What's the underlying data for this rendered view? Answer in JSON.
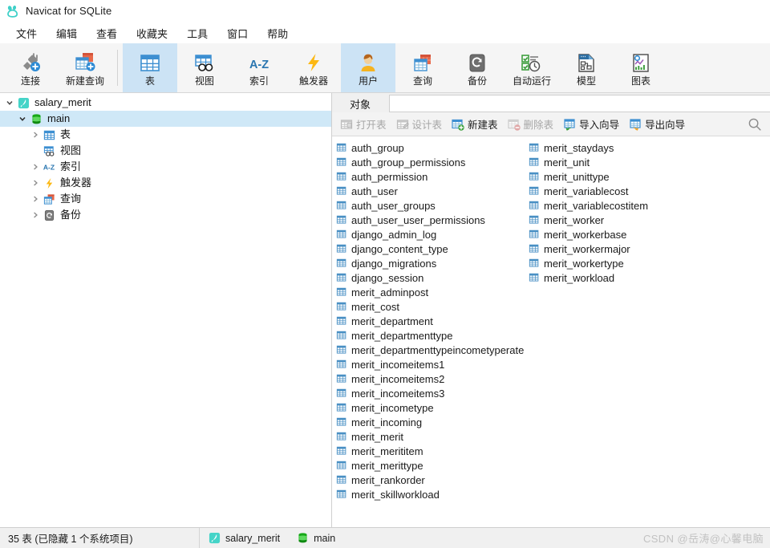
{
  "window": {
    "title": "Navicat for SQLite",
    "logo_icon": "navicat-paw-icon"
  },
  "menubar": {
    "items": [
      {
        "label": "文件",
        "name": "menu-file"
      },
      {
        "label": "编辑",
        "name": "menu-edit"
      },
      {
        "label": "查看",
        "name": "menu-view"
      },
      {
        "label": "收藏夹",
        "name": "menu-favorites"
      },
      {
        "label": "工具",
        "name": "menu-tools"
      },
      {
        "label": "窗口",
        "name": "menu-window"
      },
      {
        "label": "帮助",
        "name": "menu-help"
      }
    ]
  },
  "toolbar": {
    "items": [
      {
        "label": "连接",
        "icon": "connection-plug-icon",
        "active": false
      },
      {
        "label": "新建查询",
        "icon": "new-query-icon",
        "active": false
      },
      {
        "label": "表",
        "icon": "table-icon",
        "active": true
      },
      {
        "label": "视图",
        "icon": "view-icon",
        "active": false
      },
      {
        "label": "索引",
        "icon": "index-az-icon",
        "active": false
      },
      {
        "label": "触发器",
        "icon": "trigger-bolt-icon",
        "active": false
      },
      {
        "label": "用户",
        "icon": "user-icon",
        "active": true
      },
      {
        "label": "查询",
        "icon": "query-icon",
        "active": false
      },
      {
        "label": "备份",
        "icon": "backup-icon",
        "active": false
      },
      {
        "label": "自动运行",
        "icon": "automation-icon",
        "active": false
      },
      {
        "label": "模型",
        "icon": "model-icon",
        "active": false
      },
      {
        "label": "图表",
        "icon": "chart-icon",
        "active": false
      }
    ]
  },
  "sidebar": {
    "nodes": [
      {
        "label": "salary_merit",
        "icon": "sqlite-file-icon",
        "indent": 0,
        "twisty": "expanded",
        "selected": false
      },
      {
        "label": "main",
        "icon": "database-icon",
        "indent": 1,
        "twisty": "expanded",
        "selected": true
      },
      {
        "label": "表",
        "icon": "table-icon",
        "indent": 2,
        "twisty": "collapsed",
        "selected": false
      },
      {
        "label": "视图",
        "icon": "view-icon",
        "indent": 2,
        "twisty": "none",
        "selected": false
      },
      {
        "label": "索引",
        "icon": "index-az-icon",
        "indent": 2,
        "twisty": "collapsed",
        "selected": false
      },
      {
        "label": "触发器",
        "icon": "trigger-bolt-icon",
        "indent": 2,
        "twisty": "collapsed",
        "selected": false
      },
      {
        "label": "查询",
        "icon": "query-icon",
        "indent": 2,
        "twisty": "collapsed",
        "selected": false
      },
      {
        "label": "备份",
        "icon": "backup-icon",
        "indent": 2,
        "twisty": "collapsed",
        "selected": false
      }
    ]
  },
  "main": {
    "tab": {
      "label": "对象",
      "name": "tab-objects"
    },
    "objectbar": {
      "items": [
        {
          "label": "打开表",
          "icon": "open-table-icon",
          "disabled": true,
          "name": "open-table-button"
        },
        {
          "label": "设计表",
          "icon": "design-table-icon",
          "disabled": true,
          "name": "design-table-button"
        },
        {
          "label": "新建表",
          "icon": "new-table-icon",
          "disabled": false,
          "name": "new-table-button"
        },
        {
          "label": "删除表",
          "icon": "delete-table-icon",
          "disabled": true,
          "name": "delete-table-button"
        },
        {
          "label": "导入向导",
          "icon": "import-wizard-icon",
          "disabled": false,
          "name": "import-wizard-button"
        },
        {
          "label": "导出向导",
          "icon": "export-wizard-icon",
          "disabled": false,
          "name": "export-wizard-button"
        }
      ],
      "search_icon": "search-icon",
      "highlight": {
        "target": "import-wizard-button",
        "color": "#ef1c1c"
      }
    },
    "tables_col1": [
      "auth_group",
      "auth_group_permissions",
      "auth_permission",
      "auth_user",
      "auth_user_groups",
      "auth_user_user_permissions",
      "django_admin_log",
      "django_content_type",
      "django_migrations",
      "django_session",
      "merit_adminpost",
      "merit_cost",
      "merit_department",
      "merit_departmenttype",
      "merit_departmenttypeincometyperate",
      "merit_incomeitems1",
      "merit_incomeitems2",
      "merit_incomeitems3",
      "merit_incometype",
      "merit_incoming",
      "merit_merit",
      "merit_merititem",
      "merit_merittype",
      "merit_rankorder",
      "merit_skillworkload"
    ],
    "tables_col2": [
      "merit_staydays",
      "merit_unit",
      "merit_unittype",
      "merit_variablecost",
      "merit_variablecostitem",
      "merit_worker",
      "merit_workerbase",
      "merit_workermajor",
      "merit_workertype",
      "merit_workload"
    ]
  },
  "statusbar": {
    "count_text": "35 表 (已隐藏 1 个系统项目)",
    "connection": "salary_merit",
    "database": "main",
    "connection_icon": "sqlite-file-icon",
    "database_icon": "database-icon",
    "watermark": "CSDN @岳涛@心馨电脑"
  },
  "colors": {
    "accent": "#3d8fd1",
    "toolbar_active": "#cce3f5",
    "tree_selected": "#cfe8f7",
    "highlight_red": "#ef1c1c",
    "table_icon": "#4a90c4",
    "db_green": "#17a818"
  }
}
